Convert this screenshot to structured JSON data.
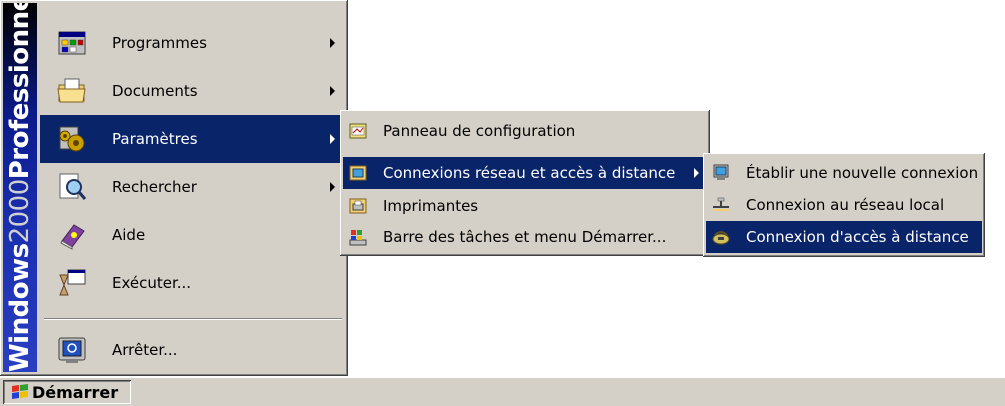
{
  "banner": {
    "word1": "Windows",
    "word2": "2000",
    "word3": "Professionnel"
  },
  "start_menu": {
    "items": [
      {
        "label": "Programmes",
        "icon": "programs-icon",
        "has_submenu": true
      },
      {
        "label": "Documents",
        "icon": "documents-folder-icon",
        "has_submenu": true
      },
      {
        "label": "Paramètres",
        "icon": "settings-icon",
        "has_submenu": true,
        "active": true
      },
      {
        "label": "Rechercher",
        "icon": "search-icon",
        "has_submenu": true
      },
      {
        "label": "Aide",
        "icon": "help-book-icon",
        "has_submenu": false
      },
      {
        "label": "Exécuter...",
        "icon": "run-icon",
        "has_submenu": false
      },
      {
        "label": "Arrêter...",
        "icon": "shutdown-icon",
        "has_submenu": false
      }
    ]
  },
  "settings_submenu": {
    "items": [
      {
        "label": "Panneau de configuration",
        "icon": "control-panel-icon"
      },
      {
        "label": "Connexions réseau et accès à distance",
        "icon": "network-connections-icon",
        "active": true,
        "has_submenu": true
      },
      {
        "label": "Imprimantes",
        "icon": "printers-icon"
      },
      {
        "label": "Barre des tâches et menu Démarrer...",
        "icon": "taskbar-icon"
      }
    ]
  },
  "connections_submenu": {
    "items": [
      {
        "label": "Établir une nouvelle connexion",
        "icon": "new-connection-icon"
      },
      {
        "label": "Connexion au réseau local",
        "icon": "lan-icon"
      },
      {
        "label": "Connexion d'accès à distance",
        "icon": "dialup-icon",
        "active": true
      }
    ]
  },
  "taskbar": {
    "start_label": "Démarrer"
  },
  "colors": {
    "menu_face": "#d4d0c8",
    "highlight": "#0a246a",
    "highlight_text": "#ffffff",
    "banner_dark": "#000000",
    "banner_blue": "#1a2fb0"
  }
}
